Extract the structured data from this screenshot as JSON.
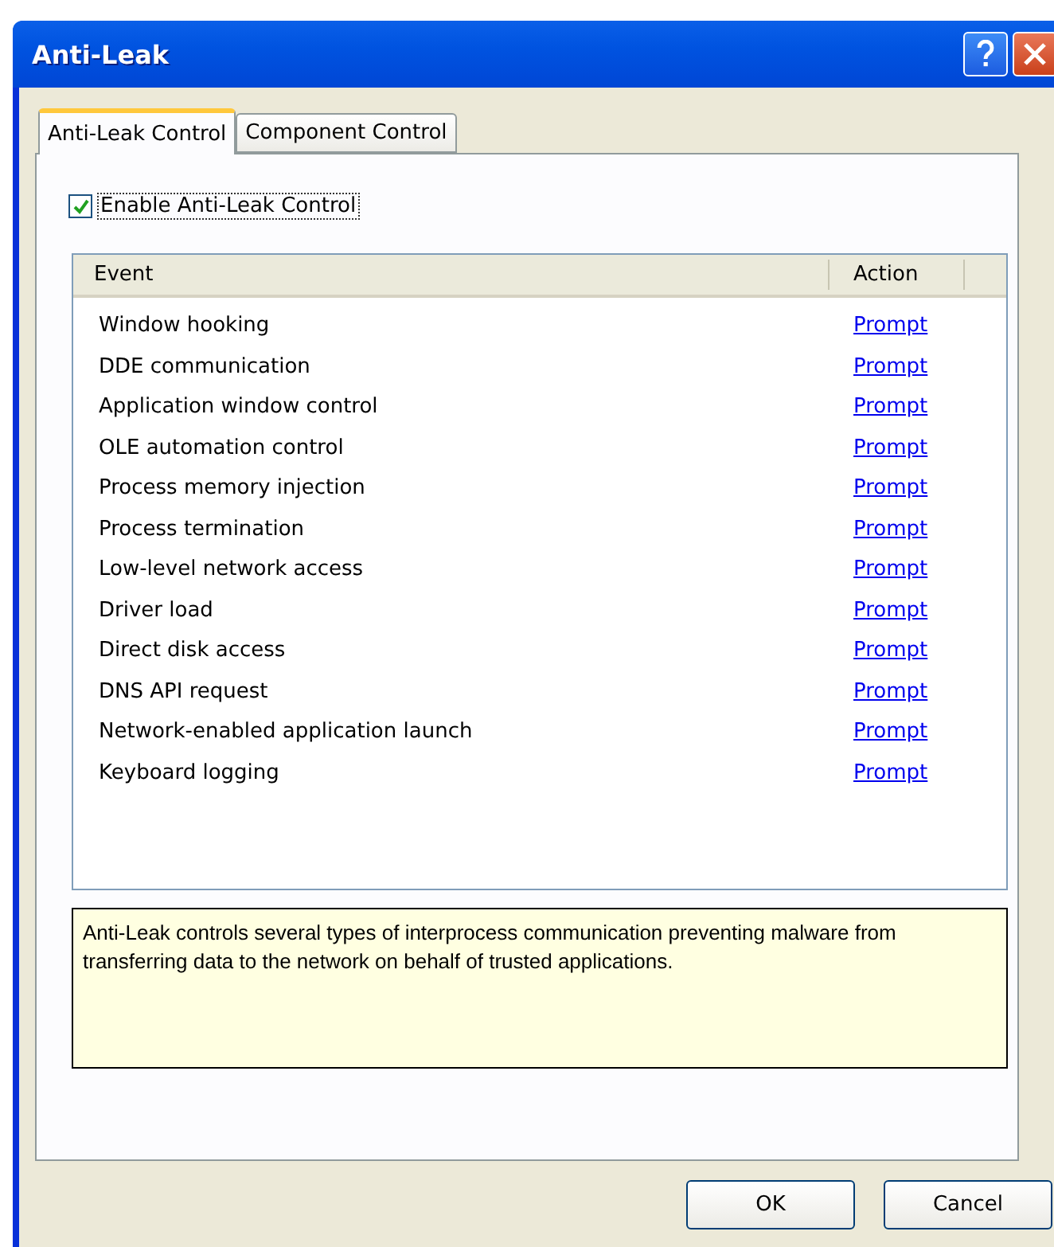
{
  "window": {
    "title": "Anti-Leak"
  },
  "tabs": [
    {
      "label": "Anti-Leak Control",
      "selected": true
    },
    {
      "label": "Component Control",
      "selected": false
    }
  ],
  "enable_checkbox": {
    "label": "Enable Anti-Leak Control",
    "checked": true
  },
  "table": {
    "columns": [
      "Event",
      "Action"
    ],
    "rows": [
      {
        "event": "Window hooking",
        "action": "Prompt"
      },
      {
        "event": "DDE communication",
        "action": "Prompt"
      },
      {
        "event": "Application window control",
        "action": "Prompt"
      },
      {
        "event": "OLE automation control",
        "action": "Prompt"
      },
      {
        "event": "Process memory injection",
        "action": "Prompt"
      },
      {
        "event": "Process termination",
        "action": "Prompt"
      },
      {
        "event": "Low-level network access",
        "action": "Prompt"
      },
      {
        "event": "Driver load",
        "action": "Prompt"
      },
      {
        "event": "Direct disk access",
        "action": "Prompt"
      },
      {
        "event": "DNS API request",
        "action": "Prompt"
      },
      {
        "event": "Network-enabled application launch",
        "action": "Prompt"
      },
      {
        "event": "Keyboard logging",
        "action": "Prompt"
      }
    ]
  },
  "description": "Anti-Leak controls several types of interprocess communication preventing malware from transferring data to the network on behalf of trusted applications.",
  "buttons": [
    "OK",
    "Cancel"
  ]
}
